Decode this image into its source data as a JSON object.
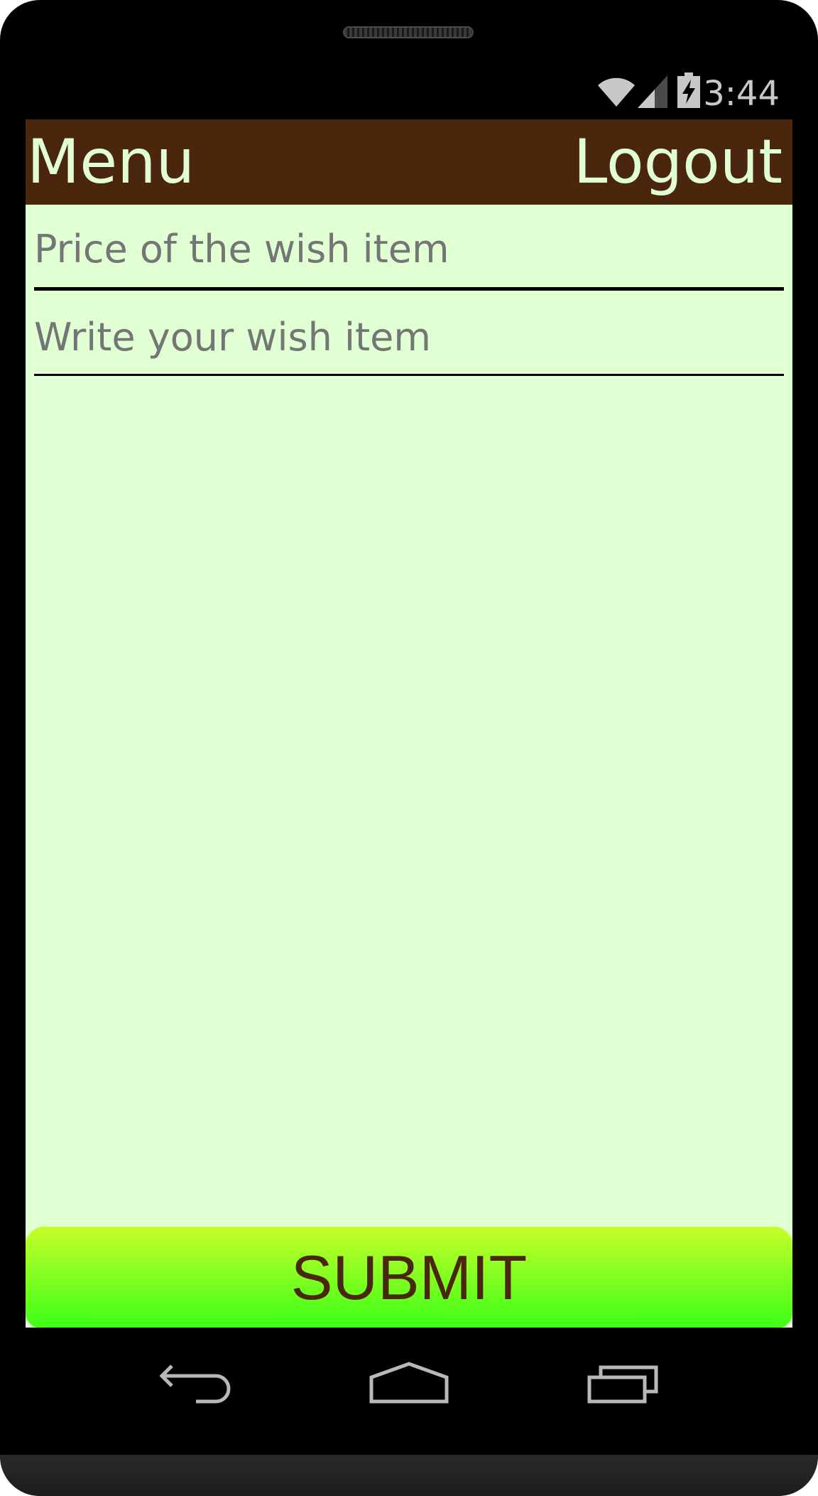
{
  "status_bar": {
    "time": "3:44",
    "icons": [
      "wifi-icon",
      "signal-icon",
      "battery-charging-icon"
    ]
  },
  "action_bar": {
    "menu_label": "Menu",
    "logout_label": "Logout"
  },
  "form": {
    "price_placeholder": "Price of the wish item",
    "price_value": "",
    "wish_placeholder": "Write your wish item",
    "wish_value": "",
    "submit_label": "SUBMIT"
  },
  "nav_bar": {
    "icons": [
      "back-icon",
      "home-icon",
      "recent-apps-icon"
    ]
  },
  "colors": {
    "action_bar_bg": "#4a270c",
    "screen_bg": "#e0ffd2",
    "action_text": "#e0ffd2",
    "submit_gradient_top": "#c6ff2a",
    "submit_gradient_bottom": "#3cff18",
    "submit_text": "#4a270c",
    "placeholder_text": "#7a8a70"
  }
}
